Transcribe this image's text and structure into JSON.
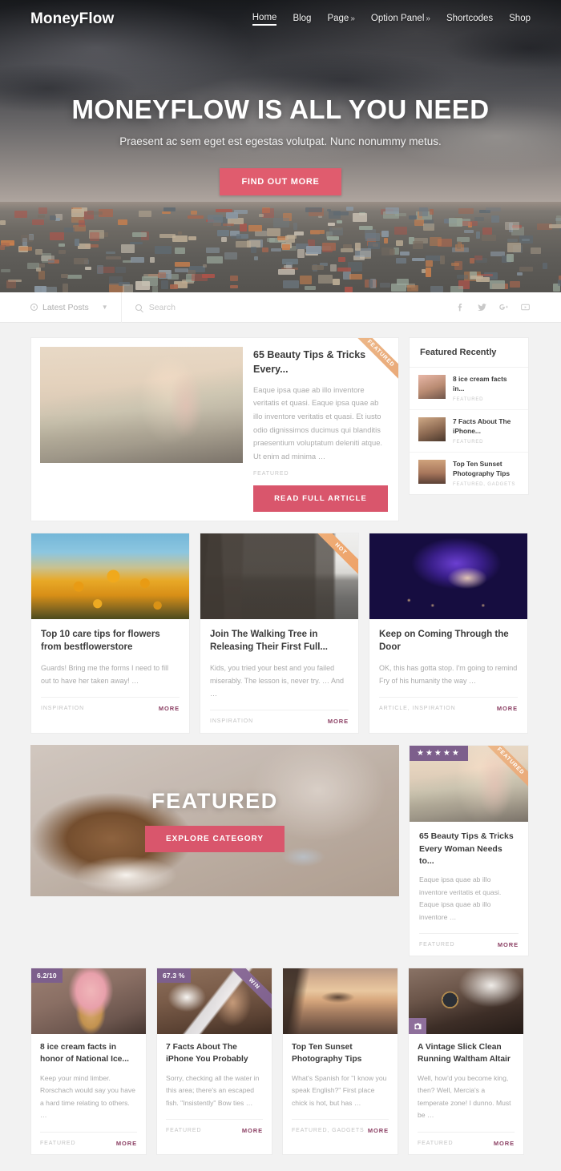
{
  "header": {
    "brand": "MoneyFlow",
    "nav": [
      {
        "label": "Home",
        "active": true,
        "caret": ""
      },
      {
        "label": "Blog",
        "active": false,
        "caret": ""
      },
      {
        "label": "Page",
        "active": false,
        "caret": "»"
      },
      {
        "label": "Option Panel",
        "active": false,
        "caret": "»"
      },
      {
        "label": "Shortcodes",
        "active": false,
        "caret": ""
      },
      {
        "label": "Shop",
        "active": false,
        "caret": ""
      }
    ]
  },
  "hero": {
    "title": "MONEYFLOW IS ALL YOU NEED",
    "subtitle": "Praesent ac sem eget est egestas volutpat. Nunc nonummy metus.",
    "cta": "FIND OUT MORE"
  },
  "filterbar": {
    "select_label": "Latest Posts",
    "search_placeholder": "Search",
    "search_value": "",
    "social": [
      "facebook-icon",
      "twitter-icon",
      "googleplus-icon",
      "youtube-icon"
    ]
  },
  "featured_post": {
    "ribbon": "FEATURED",
    "title": "65 Beauty Tips & Tricks Every...",
    "excerpt": "Eaque ipsa quae ab illo inventore veritatis et quasi. Eaque ipsa quae ab illo inventore veritatis et quasi. Et iusto odio dignissimos ducimus qui blanditis praesentium voluptatum deleniti atque. Ut enim ad minima …",
    "category": "FEATURED",
    "cta": "READ FULL ARTICLE"
  },
  "sidebar": {
    "heading": "Featured Recently",
    "items": [
      {
        "title": "8 ice cream facts in...",
        "category": "FEATURED",
        "thumb": "ph-ice-s"
      },
      {
        "title": "7 Facts About The iPhone...",
        "category": "FEATURED",
        "thumb": "ph-iphone-s"
      },
      {
        "title": "Top Ten Sunset Photography Tips",
        "category": "FEATURED, GADGETS",
        "thumb": "ph-sunset-s"
      }
    ]
  },
  "row3": [
    {
      "title": "Top 10 care tips for flowers from bestflowerstore",
      "excerpt": "Guards! Bring me the forms I need to fill out to have her taken away! …",
      "category": "INSPIRATION",
      "more": "MORE",
      "ribbon": "",
      "photo": "ph-sun"
    },
    {
      "title": "Join The Walking Tree in Releasing Their First Full...",
      "excerpt": "Kids, you tried your best and you failed miserably. The lesson is, never try. … And …",
      "category": "INSPIRATION",
      "more": "MORE",
      "ribbon": "HOT",
      "photo": "ph-road"
    },
    {
      "title": "Keep on Coming Through the Door",
      "excerpt": "OK, this has gotta stop. I'm going to remind Fry of his humanity the way …",
      "category": "ARTICLE, INSPIRATION",
      "more": "MORE",
      "ribbon": "",
      "photo": "ph-dj"
    }
  ],
  "featured_banner": {
    "label": "FEATURED",
    "cta": "EXPLORE CATEGORY"
  },
  "featured_side": {
    "rating": "★★★★★",
    "ribbon": "FEATURED",
    "title": "65 Beauty Tips & Tricks Every Woman Needs to...",
    "excerpt": "Eaque ipsa quae ab illo inventore veritatis et quasi. Eaque ipsa quae ab illo inventore …",
    "category": "FEATURED",
    "more": "MORE"
  },
  "row4": [
    {
      "badge": "6.2/10",
      "badge_type": "score",
      "ribbon": "",
      "title": "8 ice cream facts in honor of National Ice...",
      "excerpt": "Keep your mind limber. Rorschach would say you have a hard time relating to others. …",
      "category": "FEATURED",
      "more": "MORE",
      "photo": "ph-ice"
    },
    {
      "badge": "67.3 %",
      "badge_type": "score",
      "ribbon": "WIN",
      "title": "7 Facts About The iPhone You Probably",
      "excerpt": "Sorry, checking all the water in this area; there's an escaped fish. \"Insistently\" Bow ties …",
      "category": "FEATURED",
      "more": "MORE",
      "photo": "ph-phone"
    },
    {
      "badge": "",
      "badge_type": "",
      "ribbon": "",
      "title": "Top Ten Sunset Photography Tips",
      "excerpt": "What's Spanish for \"I know you speak English?\" First place chick is hot, but has …",
      "category": "FEATURED, GADGETS",
      "more": "MORE",
      "photo": "ph-sunset"
    },
    {
      "badge": "photo-icon",
      "badge_type": "photo",
      "ribbon": "",
      "title": "A Vintage Slick Clean Running Waltham Altair",
      "excerpt": "Well, how'd you become king, then? Well, Mercia's a temperate zone! I dunno. Must be …",
      "category": "FEATURED",
      "more": "MORE",
      "photo": "ph-watch"
    }
  ],
  "colors": {
    "accent_pink": "#d9566c",
    "accent_purple": "#7d5f8c",
    "ribbon_orange": "#e9a877",
    "more_link": "#8b3f63"
  }
}
